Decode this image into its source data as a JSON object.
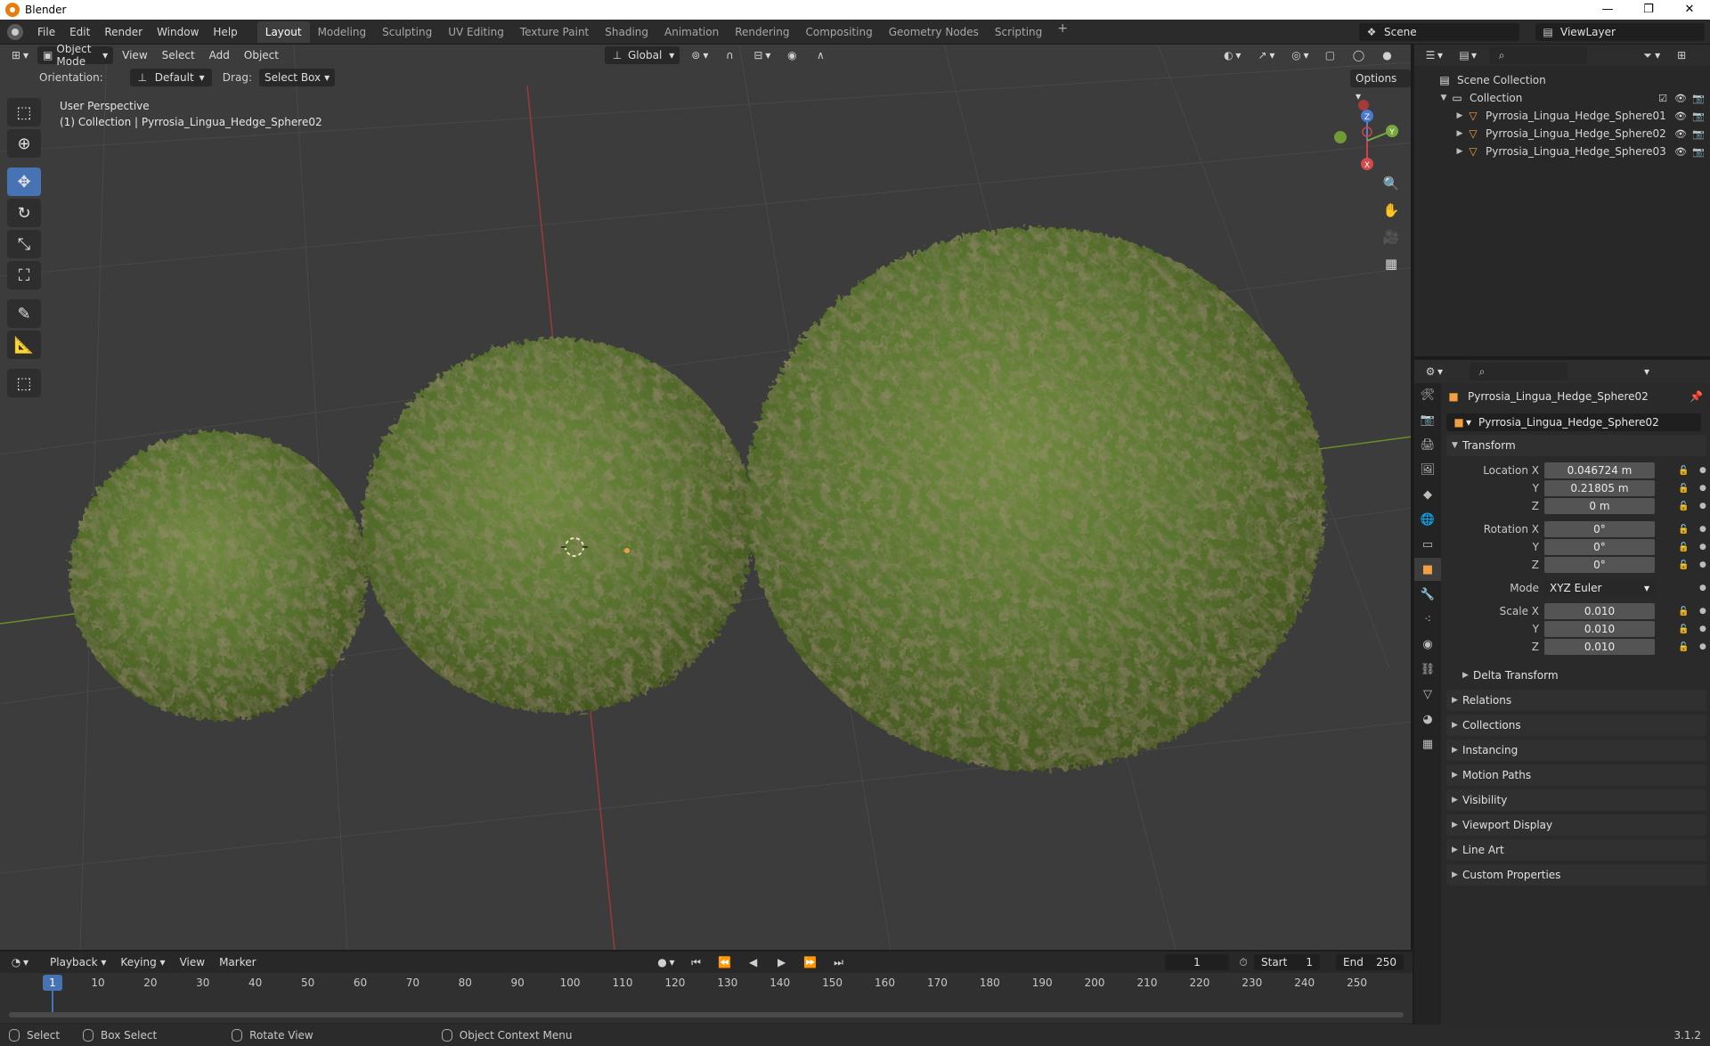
{
  "window": {
    "title": "Blender",
    "min": "—",
    "max": "❐",
    "close": "✕"
  },
  "menubar": {
    "items": [
      "File",
      "Edit",
      "Render",
      "Window",
      "Help"
    ]
  },
  "workspaces": {
    "tabs": [
      "Layout",
      "Modeling",
      "Sculpting",
      "UV Editing",
      "Texture Paint",
      "Shading",
      "Animation",
      "Rendering",
      "Compositing",
      "Geometry Nodes",
      "Scripting"
    ],
    "active": "Layout",
    "add": "+"
  },
  "scene": {
    "name": "Scene",
    "view_layer": "ViewLayer"
  },
  "viewport": {
    "mode": "Object Mode",
    "menus": [
      "View",
      "Select",
      "Add",
      "Object"
    ],
    "transform_orientation": "Global",
    "orientation_label": "Orientation:",
    "orientation_value": "Default",
    "drag_label": "Drag:",
    "drag_value": "Select Box",
    "options": "Options",
    "overlay_line1": "User Perspective",
    "overlay_line2": "(1) Collection | Pyrrosia_Lingua_Hedge_Sphere02",
    "gizmo": {
      "x": "X",
      "y": "Y",
      "z": "Z"
    }
  },
  "outliner": {
    "root": "Scene Collection",
    "collection": "Collection",
    "objects": [
      "Pyrrosia_Lingua_Hedge_Sphere01",
      "Pyrrosia_Lingua_Hedge_Sphere02",
      "Pyrrosia_Lingua_Hedge_Sphere03"
    ]
  },
  "properties": {
    "object_name": "Pyrrosia_Lingua_Hedge_Sphere02",
    "datablock_name": "Pyrrosia_Lingua_Hedge_Sphere02",
    "transform_label": "Transform",
    "location": {
      "label": "Location X",
      "x": "0.046724 m",
      "y": "0.21805 m",
      "z": "0 m"
    },
    "rotation": {
      "label": "Rotation X",
      "x": "0°",
      "y": "0°",
      "z": "0°"
    },
    "mode": {
      "label": "Mode",
      "value": "XYZ Euler"
    },
    "scale": {
      "label": "Scale X",
      "x": "0.010",
      "y": "0.010",
      "z": "0.010"
    },
    "axis_y": "Y",
    "axis_z": "Z",
    "delta": "Delta Transform",
    "panels": [
      "Relations",
      "Collections",
      "Instancing",
      "Motion Paths",
      "Visibility",
      "Viewport Display",
      "Line Art",
      "Custom Properties"
    ]
  },
  "timeline": {
    "menus": [
      "Playback",
      "Keying",
      "View",
      "Marker"
    ],
    "current_frame": "1",
    "start_label": "Start",
    "start": "1",
    "end_label": "End",
    "end": "250",
    "ticks": [
      "10",
      "20",
      "30",
      "40",
      "50",
      "60",
      "70",
      "80",
      "90",
      "100",
      "110",
      "120",
      "130",
      "140",
      "150",
      "160",
      "170",
      "180",
      "190",
      "200",
      "210",
      "220",
      "230",
      "240",
      "250"
    ],
    "playhead": "1"
  },
  "statusbar": {
    "select": "Select",
    "box_select": "Box Select",
    "rotate": "Rotate View",
    "context": "Object Context Menu",
    "version": "3.1.2"
  }
}
